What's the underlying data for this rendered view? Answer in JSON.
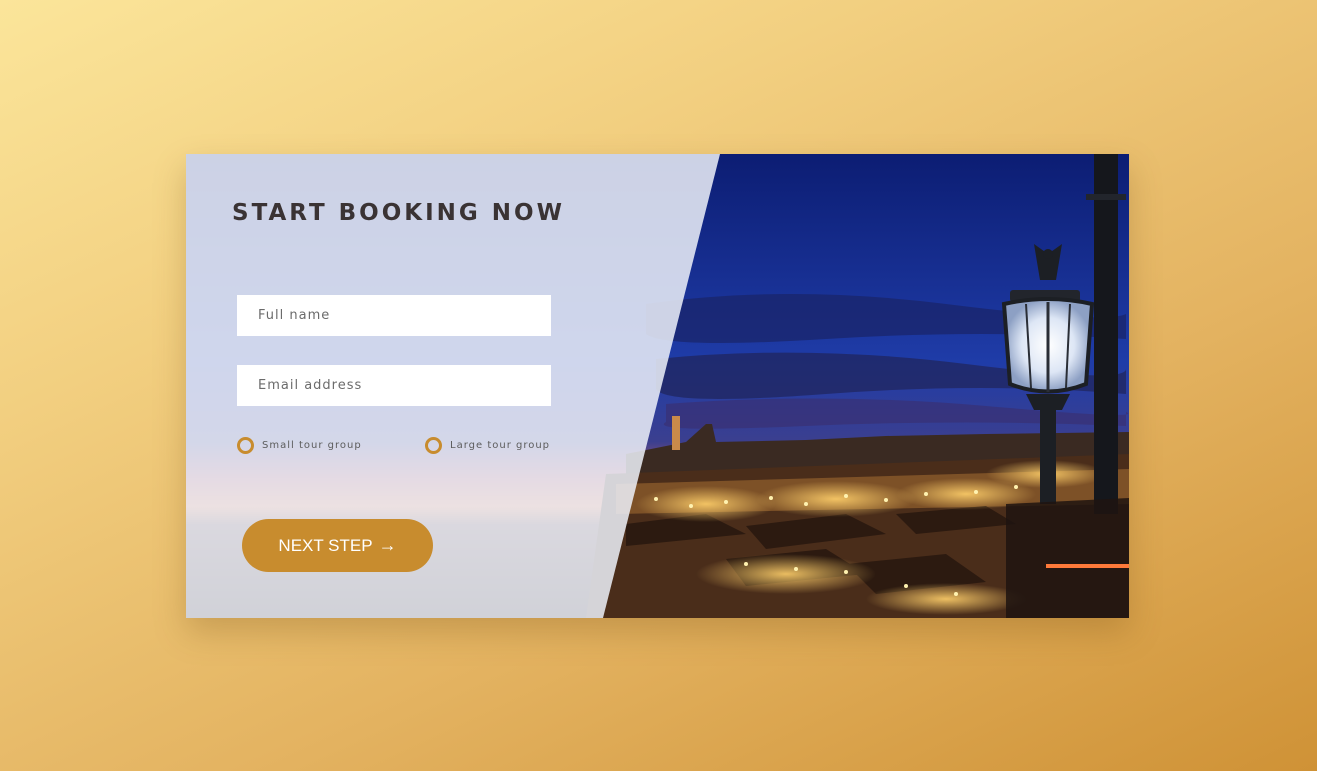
{
  "form": {
    "title": "START BOOKING NOW",
    "full_name_placeholder": "Full name",
    "email_placeholder": "Email address",
    "radio_options": [
      {
        "label": "Small tour group"
      },
      {
        "label": "Large tour group"
      }
    ],
    "next_button_label": "NEXT STEP",
    "next_button_icon": "arrow-right-icon"
  },
  "colors": {
    "accent": "#c88c2e",
    "background_start": "#fbe59a",
    "background_end": "#cf9236",
    "title_text": "#3a3334"
  }
}
